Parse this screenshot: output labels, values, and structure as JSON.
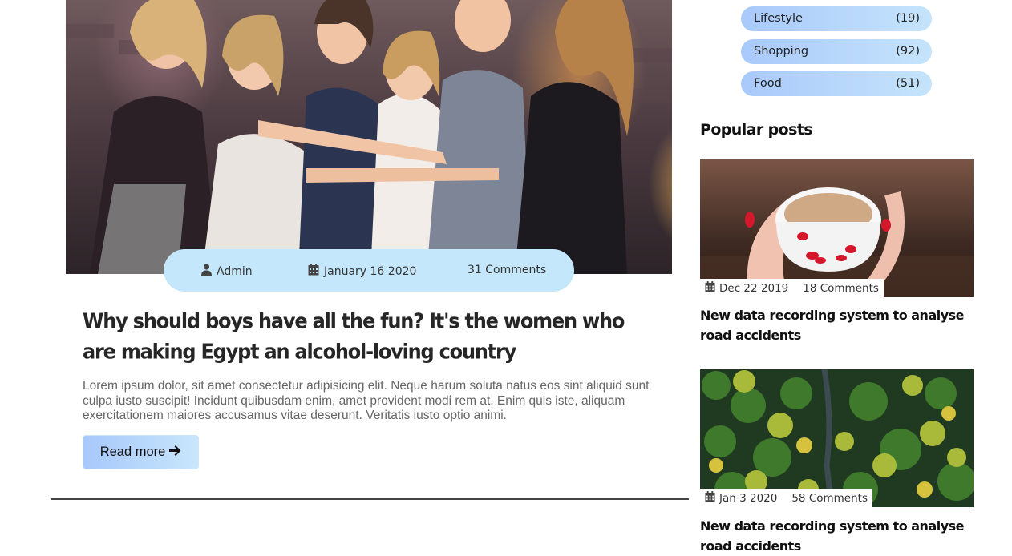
{
  "post": {
    "author": "Admin",
    "date": "January 16 2020",
    "comments": "31 Comments",
    "title": "Why should boys have all the fun? It's the women who are making Egypt an alcohol-loving country",
    "excerpt": "Lorem ipsum dolor, sit amet consectetur adipisicing elit. Neque harum soluta natus eos sint aliquid sunt culpa iusto suscipit! Incidunt quibusdam enim, amet provident modi rem at. Enim quis iste, aliquam exercitationem maiores accusamus vitae deserunt. Veritatis iusto optio animi.",
    "read_more": "Read more"
  },
  "sidebar": {
    "categories": [
      {
        "name": "Lifestyle",
        "count": "(19)"
      },
      {
        "name": "Shopping",
        "count": "(92)"
      },
      {
        "name": "Food",
        "count": "(51)"
      }
    ],
    "popular_heading": "Popular posts",
    "popular_posts": [
      {
        "date": "Dec 22 2019",
        "comments": "18 Comments",
        "title": "New data recording system to analyse road accidents"
      },
      {
        "date": "Jan 3 2020",
        "comments": "58 Comments",
        "title": "New data recording system to analyse road accidents"
      }
    ]
  },
  "colors": {
    "meta_bar": "#c4e7fb",
    "pill_gradient_start": "#a9c9fb",
    "pill_gradient_end": "#c5e4fb",
    "divider": "#444444"
  },
  "icons": [
    "user-icon",
    "calendar-icon",
    "arrow-right-icon"
  ]
}
